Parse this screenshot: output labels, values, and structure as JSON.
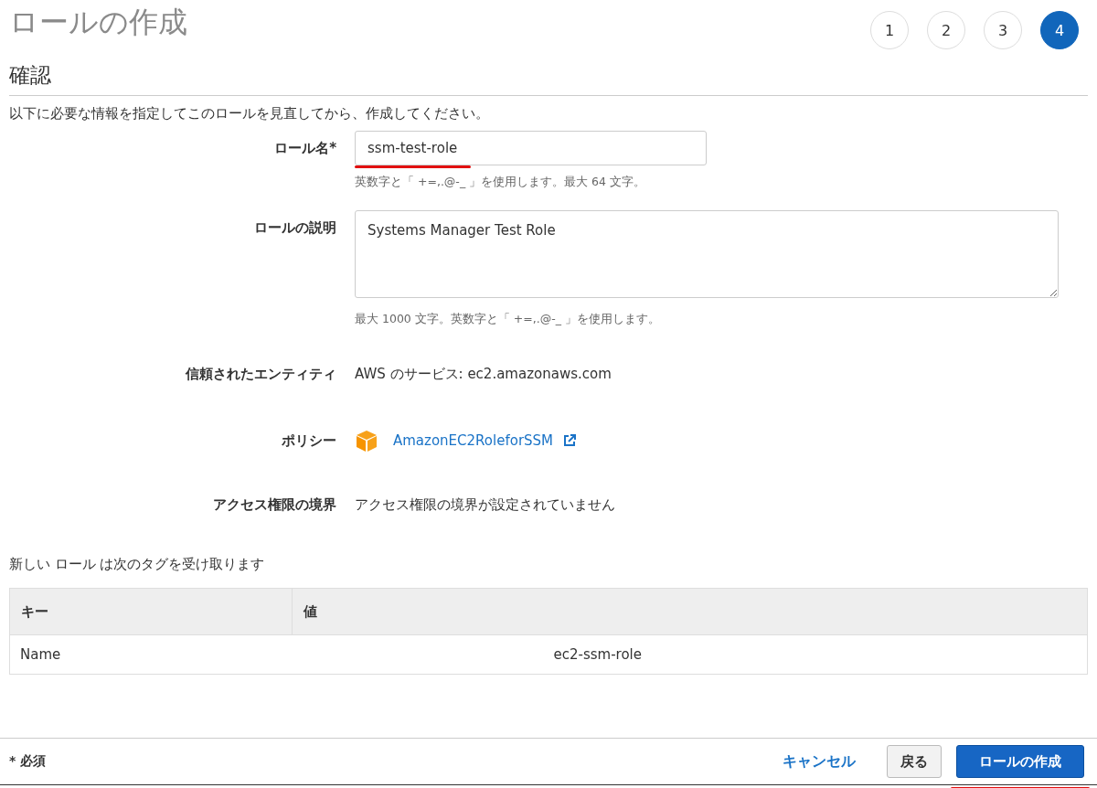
{
  "page_title": "ロールの作成",
  "steps": [
    {
      "label": "1",
      "selected": false
    },
    {
      "label": "2",
      "selected": false
    },
    {
      "label": "3",
      "selected": false
    },
    {
      "label": "4",
      "selected": true
    }
  ],
  "section_title": "確認",
  "intro": "以下に必要な情報を指定してこのロールを見直してから、作成してください。",
  "role_name": {
    "label": "ロール名*",
    "value": "ssm-test-role",
    "hint": "英数字と「 +=,.@-_ 」を使用します。最大 64 文字。"
  },
  "role_description": {
    "label": "ロールの説明",
    "value": "Systems Manager Test Role",
    "hint": "最大 1000 文字。英数字と「 +=,.@-_ 」を使用します。"
  },
  "trusted_entity": {
    "label": "信頼されたエンティティ",
    "value": "AWS のサービス: ec2.amazonaws.com"
  },
  "policies": {
    "label": "ポリシー",
    "items": [
      "AmazonEC2RoleforSSM"
    ]
  },
  "permissions_boundary": {
    "label": "アクセス権限の境界",
    "value": "アクセス権限の境界が設定されていません"
  },
  "tags": {
    "caption": "新しい ロール は次のタグを受け取ります",
    "columns": [
      "キー",
      "値"
    ],
    "rows": [
      [
        "Name",
        "ec2-ssm-role"
      ]
    ]
  },
  "footer": {
    "required_note": "* 必須",
    "cancel": "キャンセル",
    "back": "戻る",
    "create": "ロールの作成"
  }
}
